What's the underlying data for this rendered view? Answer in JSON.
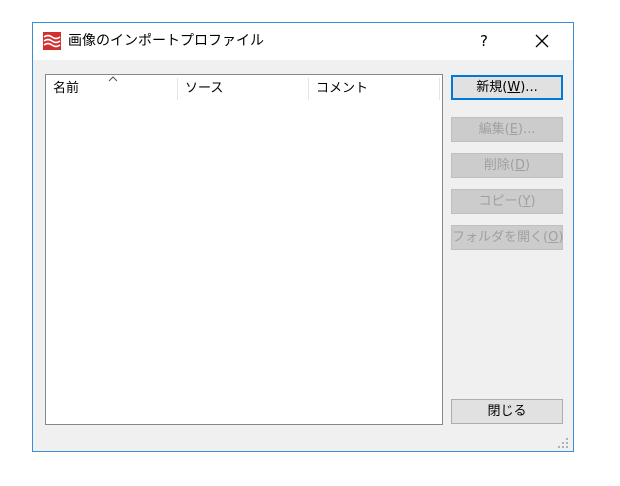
{
  "window": {
    "title": "画像のインポートプロファイル",
    "help_label": "?"
  },
  "list": {
    "columns": [
      "名前",
      "ソース",
      "コメント"
    ],
    "sorted_column": "名前",
    "rows": []
  },
  "buttons": {
    "new": {
      "label": "新規(",
      "mnemonic": "W",
      "suffix": ")..."
    },
    "edit": {
      "label": "編集(",
      "mnemonic": "E",
      "suffix": ")..."
    },
    "delete": {
      "label": "削除(",
      "mnemonic": "D",
      "suffix": ")"
    },
    "copy": {
      "label": "コピー(",
      "mnemonic": "Y",
      "suffix": ")"
    },
    "open_folder": {
      "label": "フォルダを開く(",
      "mnemonic": "O",
      "suffix": ")"
    },
    "close": {
      "label": "閉じる"
    }
  },
  "colors": {
    "window_border": "#3b8fd9",
    "default_button_border": "#0078d7",
    "icon_red": "#d32f2f"
  },
  "icons": {
    "app": "app-logo-icon",
    "close": "close-icon",
    "sort": "sort-ascending-icon",
    "resize": "resize-grip-icon"
  }
}
